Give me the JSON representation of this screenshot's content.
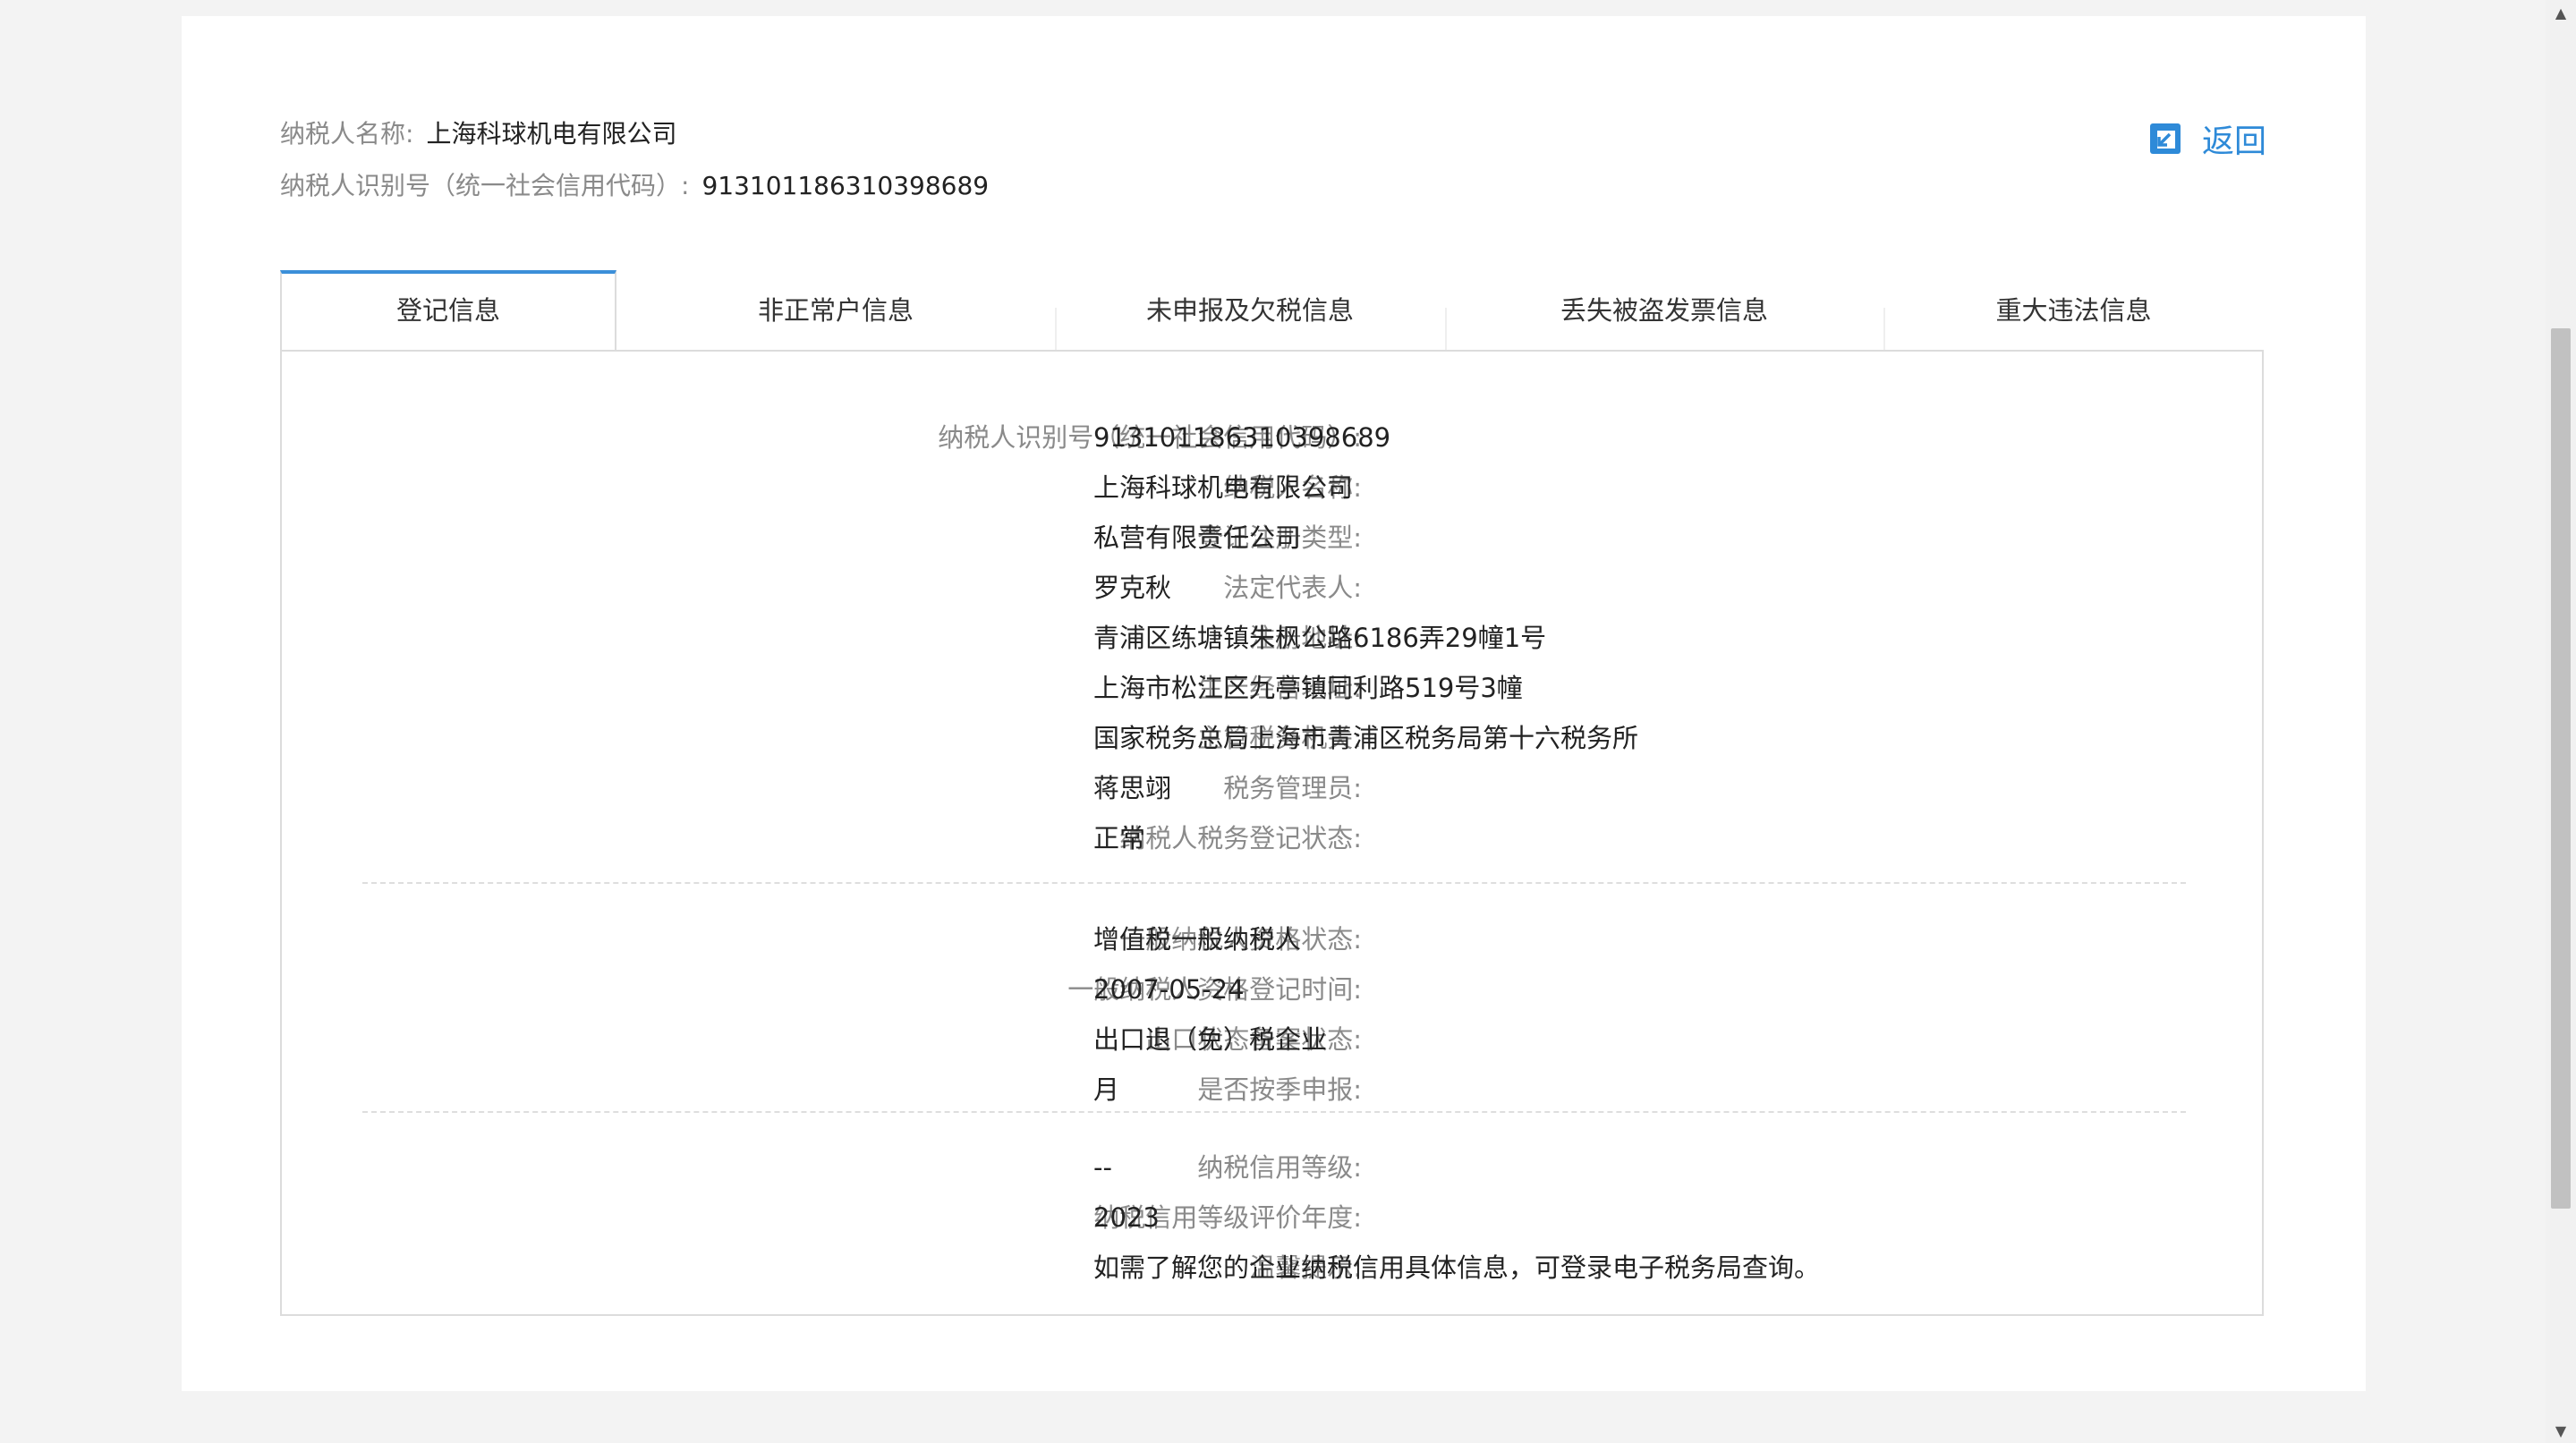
{
  "header": {
    "name_label": "纳税人名称:",
    "name_value": "上海科球机电有限公司",
    "id_label": "纳税人识别号（统一社会信用代码）:",
    "id_value": "913101186310398689",
    "back_label": "返回"
  },
  "tabs": [
    {
      "label": "登记信息",
      "active": true
    },
    {
      "label": "非正常户信息",
      "active": false
    },
    {
      "label": "未申报及欠税信息",
      "active": false
    },
    {
      "label": "丢失被盗发票信息",
      "active": false
    },
    {
      "label": "重大违法信息",
      "active": false
    }
  ],
  "sections": [
    {
      "rows": [
        {
          "key": "纳税人识别号（统一社会信用代码）:",
          "value": "913101186310398689"
        },
        {
          "key": "纳税人名称:",
          "value": "上海科球机电有限公司"
        },
        {
          "key": "登记注册类型:",
          "value": "私营有限责任公司"
        },
        {
          "key": "法定代表人:",
          "value": "罗克秋"
        },
        {
          "key": "注册地址:",
          "value": "青浦区练塘镇朱枫公路6186弄29幢1号"
        },
        {
          "key": "生产经营地址:",
          "value": "上海市松江区九亭镇同利路519号3幢"
        },
        {
          "key": "主管税务机关:",
          "value": "国家税务总局上海市青浦区税务局第十六税务所"
        },
        {
          "key": "税务管理员:",
          "value": "蒋思翊"
        },
        {
          "key": "纳税人税务登记状态:",
          "value": "正常"
        }
      ]
    },
    {
      "rows": [
        {
          "key": "一般纳税人资格状态:",
          "value": "增值税一般纳税人"
        },
        {
          "key": "一般纳税人资格登记时间:",
          "value": "2007-05-24"
        },
        {
          "key": "出口状态备案状态:",
          "value": "出口退（免）税企业"
        },
        {
          "key": "是否按季申报:",
          "value": "月"
        }
      ]
    },
    {
      "rows": [
        {
          "key": "纳税信用等级:",
          "value": "--"
        },
        {
          "key": "纳税信用等级评价年度:",
          "value": "2023"
        },
        {
          "key": "温馨提示:",
          "value": "如需了解您的企业纳税信用具体信息，可登录电子税务局查询。"
        }
      ]
    }
  ],
  "colors": {
    "accent": "#2e8ad8",
    "tab_active_border": "#3b8fd9",
    "label_gray": "#8a8a8a",
    "page_bg": "#f3f3f3"
  },
  "icons": {
    "back": "back-arrow-icon",
    "scroll_up": "chevron-up-icon",
    "scroll_down": "chevron-down-icon"
  }
}
